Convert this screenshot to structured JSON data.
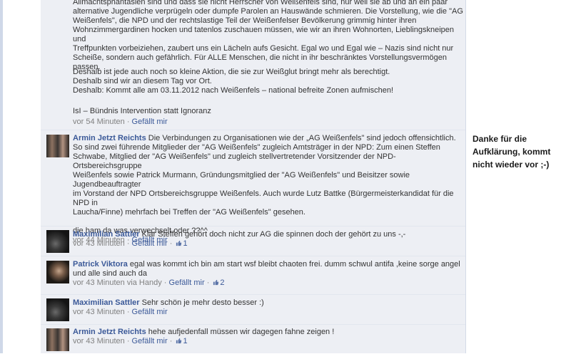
{
  "post": {
    "para1": [
      "Allmachtsphantasien sind und dass sie nicht Herrscher von Weißenfels sind, nur weil sie ab und an ein paar",
      "alternative Jugendliche verprügeln oder dumpfe Parolen an Hauswände schmieren. Die Vorstellung, wie die \"AG",
      "Weißenfels\", die NPD und der rechtslastige Teil der Weißenfelser Bevölkerung grimmig hinter ihren",
      "Wohnzimmergardinen hocken und tatenlos zuschauen müssen, wie wir an ihren Wohnorten, Lieblingskneipen und",
      "Treffpunkten vorbeiziehen, zaubert uns ein Lächeln aufs Gesicht. Egal wo und Egal wie – Nazis sind nicht nur",
      "Scheiße, sondern auch gefährlich. Für ALLE Menschen, die nicht in ihr beschränktes Vorstellungsvermögen passen."
    ],
    "para2": [
      "Deshalb ist jede auch noch so kleine Aktion, die sie zur Weißglut bringt mehr als berechtigt.",
      "Deshalb sind wir an diesem Tag vor Ort.",
      "Deshalb: Kommt alle am 03.11.2012 nach Weißenfels – national befreite Zonen aufmischen!"
    ],
    "signature": "IsI – Bündnis Intervention statt Ignoranz",
    "time": "vor 54 Minuten",
    "like_label": "Gefällt mir"
  },
  "comments": [
    {
      "author": "Armin Jetzt Reichts",
      "lines": [
        "Die Verbindungen zu Organisationen wie der „AG Weißenfels\" sind jedoch offensichtlich.",
        "So sind zwei führende Mitglieder der \"AG Weißenfels\" zugleich Amtsträger in der NPD: Zum einen Steffen",
        "Schwabe, Mitglied der \"AG Weißenfels\" und zugleich stellvertretender Vorsitzender der NPD-Ortsbereichsgruppe",
        "Weißenfels sowie Patrick Murmann, Gründungsmitglied der \"AG Weißenfels\" und Beisitzer sowie Jugendbeauftragter",
        "im Vorstand der NPD Ortsbereichsgruppe Weißenfels. Auch wurde Lutz Battke (Bürgermeisterkandidat für die NPD in",
        "Laucha/Finne) mehrfach bei Treffen der \"AG Weißenfels\" gesehen."
      ],
      "extra": "die ham da was verwechselt oder ??^^",
      "time": "vor 44 Minuten",
      "like_label": "Gefällt mir"
    },
    {
      "author": "Maximilian Sattler",
      "text": "Klar Steffen gehört doch nicht zur AG die spinnen doch der gehört zu uns -,-",
      "time": "vor 43 Minuten",
      "like_label": "Gefällt mir",
      "likes": "1"
    },
    {
      "author": "Patrick Viktora",
      "text": "egal was kommt ich bin am start wsf bleibt chaoten frei. dumm schwul antifa ,keine sorge angel",
      "text2": "und alle sind auch da",
      "time": "vor 43 Minuten via Handy",
      "like_label": "Gefällt mir",
      "likes": "2"
    },
    {
      "author": "Maximilian Sattler",
      "text": "Sehr schön je mehr desto besser :)",
      "time": "vor 43 Minuten",
      "like_label": "Gefällt mir"
    },
    {
      "author": "Armin Jetzt Reichts",
      "text": "hehe aufjedenfall müssen wir dagegen fahne zeigen !",
      "time": "vor 43 Minuten",
      "like_label": "Gefällt mir",
      "likes": "1"
    }
  ],
  "side_note": {
    "lines": [
      "Danke für die",
      "Aufklärung, kommt",
      "nicht wieder vor ;-)"
    ]
  },
  "colors": {
    "link": "#3b5998",
    "feed_bg": "#edeff4",
    "meta": "#808080"
  },
  "icons": {
    "like": "thumbs-up-icon"
  }
}
